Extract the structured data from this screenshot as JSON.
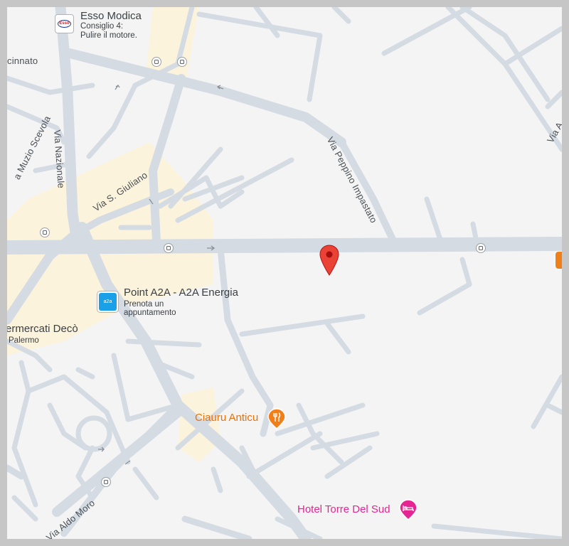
{
  "pois": {
    "esso": {
      "name": "Esso Modica",
      "line1": "Consiglio 4:",
      "line2": "Pulire il motore.",
      "logo": "Esso",
      "icon": "esso-logo-icon"
    },
    "a2a": {
      "name": "Point A2A - A2A Energia",
      "line1": "Prenota un",
      "line2": "appuntamento",
      "logo": "a2a",
      "icon": "a2a-logo-icon"
    },
    "deco": {
      "name": "ermercati Decò",
      "line1": "Palermo"
    },
    "ciauru": {
      "name": "Ciauru Anticu",
      "icon": "restaurant-icon",
      "color": "#e8710a"
    },
    "hotel": {
      "name": "Hotel Torre Del Sud",
      "icon": "hotel-icon",
      "color": "#e52592"
    }
  },
  "streets": {
    "cinnato": "cinnato",
    "muzio": "a Muzio Scevola",
    "nazionale": "Via Nazionale",
    "giuliano": "Via S. Giuliano",
    "peppino": "Via Peppino Impastato",
    "aldo_moro": "Via Aldo Moro",
    "via_a": "Via A"
  },
  "marker": {
    "icon": "location-pin-icon",
    "color": "#ea4335"
  },
  "colors": {
    "road": "#d4dbe3",
    "land": "#f4f4f4",
    "area": "#fbf3dc",
    "frame": "#c6c6c6"
  }
}
